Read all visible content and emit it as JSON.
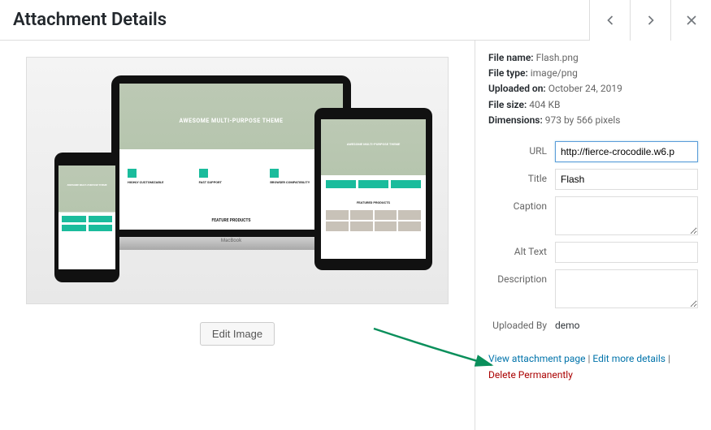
{
  "header": {
    "title": "Attachment Details"
  },
  "preview": {
    "edit_image_label": "Edit Image",
    "hero_text": "AWESOME MULTI-PURPOSE THEME",
    "feature_products": "FEATURE PRODUCTS",
    "featured_products_alt": "FEATURED PRODUCTS",
    "feat1": "HIGHLY CUSTOMIZABLE",
    "feat2": "FAST SUPPORT",
    "feat3": "BROWSER COMPATIBILITY",
    "macbook": "MacBook"
  },
  "meta": {
    "filename_label": "File name:",
    "filename_value": "Flash.png",
    "filetype_label": "File type:",
    "filetype_value": "image/png",
    "uploaded_label": "Uploaded on:",
    "uploaded_value": "October 24, 2019",
    "filesize_label": "File size:",
    "filesize_value": "404 KB",
    "dimensions_label": "Dimensions:",
    "dimensions_value": "973 by 566 pixels"
  },
  "fields": {
    "url_label": "URL",
    "url_value": "http://fierce-crocodile.w6.p",
    "title_label": "Title",
    "title_value": "Flash",
    "caption_label": "Caption",
    "caption_value": "",
    "alt_label": "Alt Text",
    "alt_value": "",
    "description_label": "Description",
    "description_value": "",
    "uploaded_by_label": "Uploaded By",
    "uploaded_by_value": "demo"
  },
  "links": {
    "view_page": "View attachment page",
    "edit_more": "Edit more details",
    "delete": "Delete Permanently",
    "sep": " | "
  }
}
